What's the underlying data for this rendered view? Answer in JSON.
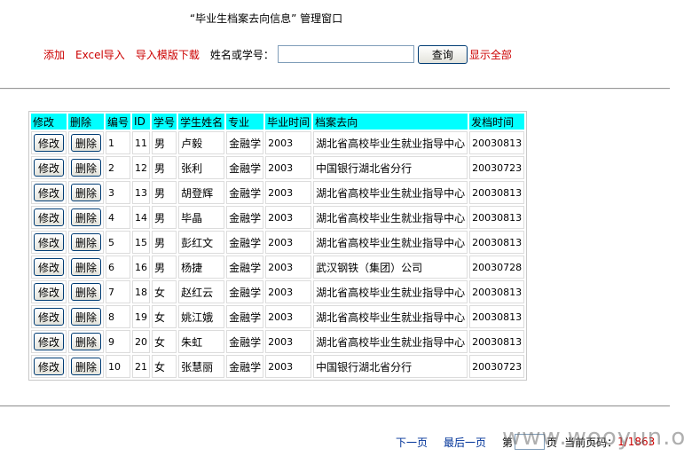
{
  "page": {
    "title": "“毕业生档案去向信息” 管理窗口"
  },
  "toolbar": {
    "add": "添加",
    "excel_import": "Excel导入",
    "template_download": "导入模版下载",
    "search_label": "姓名或学号：",
    "search_value": "",
    "query_button": "查询",
    "show_all": "显示全部"
  },
  "table": {
    "headers": [
      "修改",
      "删除",
      "编号",
      "ID",
      "学号",
      "学生姓名",
      "专业",
      "毕业时间",
      "档案去向",
      "发档时间"
    ],
    "edit_label": "修改",
    "delete_label": "删除",
    "rows": [
      {
        "no": "1",
        "id": "11",
        "sex": "男",
        "name": "卢毅",
        "major": "金融学",
        "grad": "2003",
        "dest": "湖北省高校毕业生就业指导中心",
        "date": "20030813"
      },
      {
        "no": "2",
        "id": "12",
        "sex": "男",
        "name": "张利",
        "major": "金融学",
        "grad": "2003",
        "dest": "中国银行湖北省分行",
        "date": "20030723"
      },
      {
        "no": "3",
        "id": "13",
        "sex": "男",
        "name": "胡登辉",
        "major": "金融学",
        "grad": "2003",
        "dest": "湖北省高校毕业生就业指导中心",
        "date": "20030813"
      },
      {
        "no": "4",
        "id": "14",
        "sex": "男",
        "name": "毕晶",
        "major": "金融学",
        "grad": "2003",
        "dest": "湖北省高校毕业生就业指导中心",
        "date": "20030813"
      },
      {
        "no": "5",
        "id": "15",
        "sex": "男",
        "name": "彭红文",
        "major": "金融学",
        "grad": "2003",
        "dest": "湖北省高校毕业生就业指导中心",
        "date": "20030813"
      },
      {
        "no": "6",
        "id": "16",
        "sex": "男",
        "name": "杨捷",
        "major": "金融学",
        "grad": "2003",
        "dest": "武汉钢铁（集团）公司",
        "date": "20030728"
      },
      {
        "no": "7",
        "id": "18",
        "sex": "女",
        "name": "赵红云",
        "major": "金融学",
        "grad": "2003",
        "dest": "湖北省高校毕业生就业指导中心",
        "date": "20030813"
      },
      {
        "no": "8",
        "id": "19",
        "sex": "女",
        "name": "姚江娥",
        "major": "金融学",
        "grad": "2003",
        "dest": "湖北省高校毕业生就业指导中心",
        "date": "20030813"
      },
      {
        "no": "9",
        "id": "20",
        "sex": "女",
        "name": "朱虹",
        "major": "金融学",
        "grad": "2003",
        "dest": "湖北省高校毕业生就业指导中心",
        "date": "20030813"
      },
      {
        "no": "10",
        "id": "21",
        "sex": "女",
        "name": "张慧丽",
        "major": "金融学",
        "grad": "2003",
        "dest": "中国银行湖北省分行",
        "date": "20030723"
      }
    ]
  },
  "pager": {
    "next": "下一页",
    "last": "最后一页",
    "goto_prefix": "第",
    "goto_suffix": "页",
    "current_label": "当前页码：",
    "current_value": "1/1863"
  },
  "watermark": "www.wooyun.org",
  "colors": {
    "header_bg": "#00ffff",
    "link_red": "#cc0000",
    "pager_blue": "#003399"
  }
}
